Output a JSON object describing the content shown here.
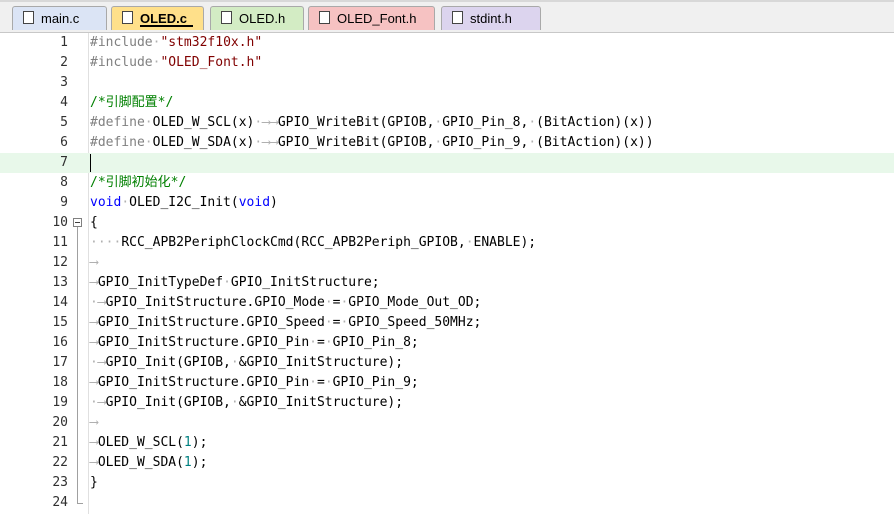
{
  "tabs": [
    {
      "label": "main.c",
      "color": "#dbe4f5",
      "active": false,
      "modified": false
    },
    {
      "label": "OLED.c",
      "color": "#ffe08a",
      "active": true,
      "modified": false
    },
    {
      "label": "OLED.h",
      "color": "#d3ecc4",
      "active": false,
      "modified": false
    },
    {
      "label": "OLED_Font.h",
      "color": "#f6c2c2",
      "active": false,
      "modified": false
    },
    {
      "label": "stdint.h",
      "color": "#dcd4ee",
      "active": false,
      "modified": false
    }
  ],
  "editor": {
    "current_line": 7,
    "lines": [
      {
        "n": "1",
        "tokens": [
          [
            "pp",
            "#include"
          ],
          [
            "ws",
            "·"
          ],
          [
            "str",
            "\"stm32f10x.h\""
          ]
        ]
      },
      {
        "n": "2",
        "tokens": [
          [
            "pp",
            "#include"
          ],
          [
            "ws",
            "·"
          ],
          [
            "str",
            "\"OLED_Font.h\""
          ]
        ]
      },
      {
        "n": "3",
        "tokens": []
      },
      {
        "n": "4",
        "tokens": [
          [
            "cmt",
            "/*引脚配置*/"
          ]
        ]
      },
      {
        "n": "5",
        "tokens": [
          [
            "pp",
            "#define"
          ],
          [
            "ws",
            "·"
          ],
          [
            "id",
            "OLED_W_SCL(x)"
          ],
          [
            "ws",
            "·⟶"
          ],
          [
            "ws",
            "⟶"
          ],
          [
            "id",
            "GPIO_WriteBit(GPIOB,"
          ],
          [
            "ws",
            "·"
          ],
          [
            "id",
            "GPIO_Pin_8,"
          ],
          [
            "ws",
            "·"
          ],
          [
            "id",
            "(BitAction)(x))"
          ]
        ]
      },
      {
        "n": "6",
        "tokens": [
          [
            "pp",
            "#define"
          ],
          [
            "ws",
            "·"
          ],
          [
            "id",
            "OLED_W_SDA(x)"
          ],
          [
            "ws",
            "·⟶"
          ],
          [
            "ws",
            "⟶"
          ],
          [
            "id",
            "GPIO_WriteBit(GPIOB,"
          ],
          [
            "ws",
            "·"
          ],
          [
            "id",
            "GPIO_Pin_9,"
          ],
          [
            "ws",
            "·"
          ],
          [
            "id",
            "(BitAction)(x))"
          ]
        ]
      },
      {
        "n": "7",
        "tokens": []
      },
      {
        "n": "8",
        "tokens": [
          [
            "cmt",
            "/*引脚初始化*/"
          ]
        ]
      },
      {
        "n": "9",
        "tokens": [
          [
            "kw",
            "void"
          ],
          [
            "ws",
            "·"
          ],
          [
            "id",
            "OLED_I2C_Init("
          ],
          [
            "kw",
            "void"
          ],
          [
            "id",
            ")"
          ]
        ]
      },
      {
        "n": "10",
        "tokens": [
          [
            "id",
            "{"
          ]
        ]
      },
      {
        "n": "11",
        "tokens": [
          [
            "ws",
            "····"
          ],
          [
            "id",
            "RCC_APB2PeriphClockCmd(RCC_APB2Periph_GPIOB,"
          ],
          [
            "ws",
            "·"
          ],
          [
            "id",
            "ENABLE);"
          ]
        ]
      },
      {
        "n": "12",
        "tokens": [
          [
            "ws",
            "⟶"
          ]
        ]
      },
      {
        "n": "13",
        "tokens": [
          [
            "ws",
            "⟶"
          ],
          [
            "id",
            "GPIO_InitTypeDef"
          ],
          [
            "ws",
            "·"
          ],
          [
            "id",
            "GPIO_InitStructure;"
          ]
        ]
      },
      {
        "n": "14",
        "tokens": [
          [
            "ws",
            "·⟶"
          ],
          [
            "id",
            "GPIO_InitStructure.GPIO_Mode"
          ],
          [
            "ws",
            "·"
          ],
          [
            "id",
            "="
          ],
          [
            "ws",
            "·"
          ],
          [
            "id",
            "GPIO_Mode_Out_OD;"
          ]
        ]
      },
      {
        "n": "15",
        "tokens": [
          [
            "ws",
            "⟶"
          ],
          [
            "id",
            "GPIO_InitStructure.GPIO_Speed"
          ],
          [
            "ws",
            "·"
          ],
          [
            "id",
            "="
          ],
          [
            "ws",
            "·"
          ],
          [
            "id",
            "GPIO_Speed_50MHz;"
          ]
        ]
      },
      {
        "n": "16",
        "tokens": [
          [
            "ws",
            "⟶"
          ],
          [
            "id",
            "GPIO_InitStructure.GPIO_Pin"
          ],
          [
            "ws",
            "·"
          ],
          [
            "id",
            "="
          ],
          [
            "ws",
            "·"
          ],
          [
            "id",
            "GPIO_Pin_8;"
          ]
        ]
      },
      {
        "n": "17",
        "tokens": [
          [
            "ws",
            "·⟶"
          ],
          [
            "id",
            "GPIO_Init(GPIOB,"
          ],
          [
            "ws",
            "·"
          ],
          [
            "id",
            "&GPIO_InitStructure);"
          ]
        ]
      },
      {
        "n": "18",
        "tokens": [
          [
            "ws",
            "⟶"
          ],
          [
            "id",
            "GPIO_InitStructure.GPIO_Pin"
          ],
          [
            "ws",
            "·"
          ],
          [
            "id",
            "="
          ],
          [
            "ws",
            "·"
          ],
          [
            "id",
            "GPIO_Pin_9;"
          ]
        ]
      },
      {
        "n": "19",
        "tokens": [
          [
            "ws",
            "·⟶"
          ],
          [
            "id",
            "GPIO_Init(GPIOB,"
          ],
          [
            "ws",
            "·"
          ],
          [
            "id",
            "&GPIO_InitStructure);"
          ]
        ]
      },
      {
        "n": "20",
        "tokens": [
          [
            "ws",
            "⟶"
          ]
        ]
      },
      {
        "n": "21",
        "tokens": [
          [
            "ws",
            "⟶"
          ],
          [
            "id",
            "OLED_W_SCL("
          ],
          [
            "num",
            "1"
          ],
          [
            "id",
            ");"
          ]
        ]
      },
      {
        "n": "22",
        "tokens": [
          [
            "ws",
            "⟶"
          ],
          [
            "id",
            "OLED_W_SDA("
          ],
          [
            "num",
            "1"
          ],
          [
            "id",
            ");"
          ]
        ]
      },
      {
        "n": "23",
        "tokens": [
          [
            "id",
            "}"
          ]
        ]
      },
      {
        "n": "24",
        "tokens": []
      }
    ]
  }
}
